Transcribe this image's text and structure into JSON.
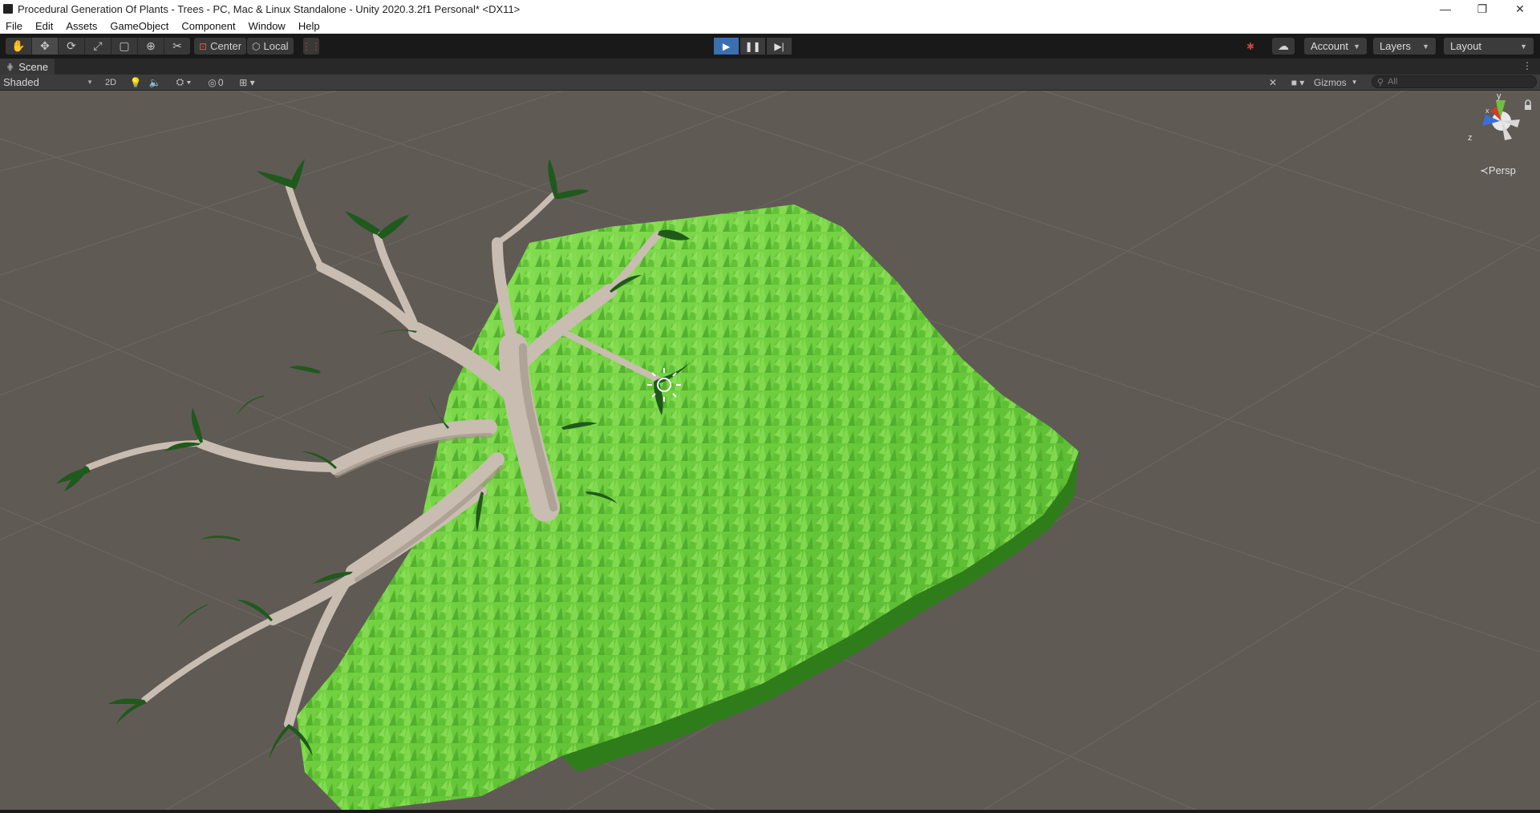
{
  "window": {
    "title": "Procedural Generation Of Plants - Trees - PC, Mac & Linux Standalone - Unity 2020.3.2f1 Personal* <DX11>",
    "controls": {
      "minimize": "—",
      "maximize": "❐",
      "close": "✕"
    }
  },
  "menu": {
    "items": [
      "File",
      "Edit",
      "Assets",
      "GameObject",
      "Component",
      "Window",
      "Help"
    ]
  },
  "toolbar": {
    "tools": [
      "hand-tool",
      "move-tool",
      "rotate-tool",
      "scale-tool",
      "rect-tool",
      "transform-tool",
      "custom-tool"
    ],
    "active_tool": "move-tool",
    "pivot_mode": "Center",
    "pivot_rotation": "Local",
    "play_state": "playing",
    "account_label": "Account",
    "layers_label": "Layers",
    "layout_label": "Layout"
  },
  "tabs": {
    "scene_label": "Scene"
  },
  "scene_toolbar": {
    "draw_mode": "Shaded",
    "mode_2d": "2D",
    "hidden_count": "0",
    "gizmos_label": "Gizmos",
    "search_placeholder": "All"
  },
  "scene": {
    "projection_label": "Persp",
    "axis_labels": {
      "y": "y",
      "z": "z",
      "x": "x"
    },
    "colors": {
      "background": "#605a55",
      "grass_light": "#7bd64a",
      "grass_dark": "#3f9a22",
      "bark": "#c9bfb3",
      "leaf": "#1f5a1c"
    }
  }
}
